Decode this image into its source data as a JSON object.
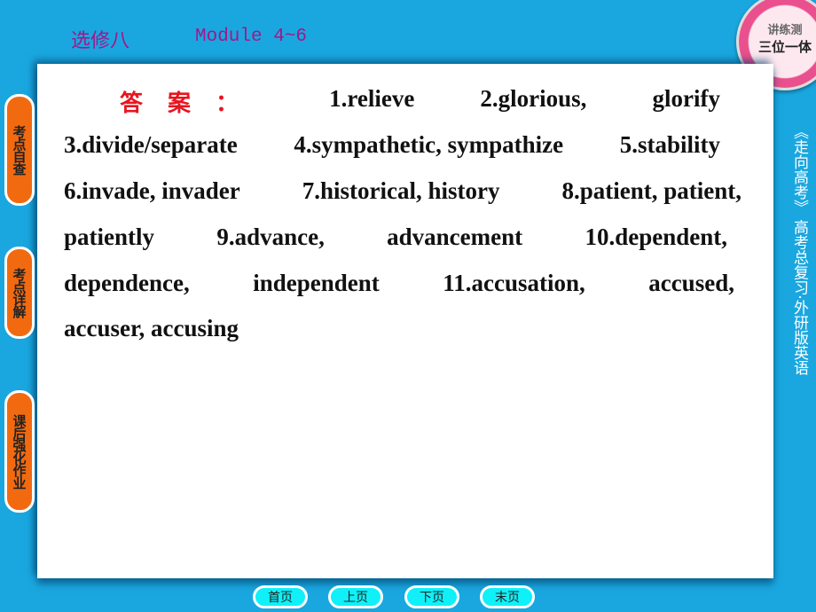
{
  "header": {
    "title_cn": "选修八",
    "title_module": "Module 4~6"
  },
  "badge": {
    "line1": "讲练测",
    "line2": "三位一体"
  },
  "answer": {
    "label": "答案：",
    "lines": [
      [
        "1.relieve",
        "2.glorious,",
        "glorify"
      ],
      [
        "3.divide/separate",
        "4.sympathetic, sympathize",
        "5.stability"
      ],
      [
        "6.invade, invader",
        "7.historical, history",
        "8.patient, patient,"
      ],
      [
        "patiently",
        "9.advance,",
        "advancement",
        "10.dependent,"
      ],
      [
        "dependence,",
        "independent",
        "11.accusation,",
        "accused,"
      ],
      [
        "accuser, accusing"
      ]
    ]
  },
  "sidebar": [
    {
      "label": "考点自查"
    },
    {
      "label": "考点详解"
    },
    {
      "label": "课后强化作业"
    }
  ],
  "right_text": "《走向高考》 高考总复习·外研版英语",
  "nav": [
    {
      "label": "首页"
    },
    {
      "label": "上页"
    },
    {
      "label": "下页"
    },
    {
      "label": "末页"
    }
  ],
  "colors": {
    "background": "#1aa7e0",
    "sidebar_button": "#f26a10",
    "nav_button": "#0ff0f8",
    "answer_label": "#e8141e",
    "title": "#a0188a"
  }
}
